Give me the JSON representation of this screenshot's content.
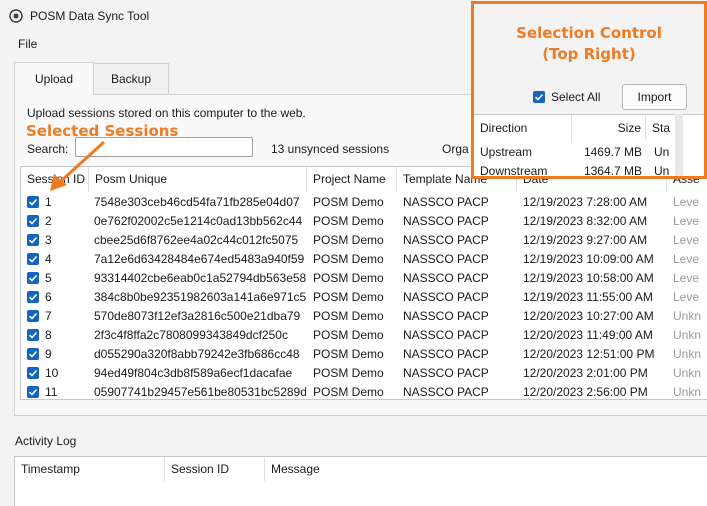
{
  "window": {
    "title": "POSM Data Sync Tool"
  },
  "menu": {
    "file": "File"
  },
  "tabs": [
    {
      "label": "Upload"
    },
    {
      "label": "Backup"
    }
  ],
  "upload": {
    "description": "Upload sessions stored on this computer to the web.",
    "search_label": "Search:",
    "search_value": "",
    "unsynced_count": "13 unsynced sessions",
    "org_label": "Orga"
  },
  "sessions_table": {
    "columns": [
      "Session ID",
      "Posm Unique",
      "Project Name",
      "Template Name",
      "Date",
      "Asse"
    ],
    "rows": [
      {
        "id": "1",
        "posm": "7548e303ceb46cd54fa71fb285e04d07",
        "project": "POSM Demo",
        "template": "NASSCO PACP",
        "date": "12/19/2023 7:28:00 AM",
        "asset": "Leve"
      },
      {
        "id": "2",
        "posm": "0e762f02002c5e1214c0ad13bb562c44",
        "project": "POSM Demo",
        "template": "NASSCO PACP",
        "date": "12/19/2023 8:32:00 AM",
        "asset": "Leve"
      },
      {
        "id": "3",
        "posm": "cbee25d6f8762ee4a02c44c012fc5075",
        "project": "POSM Demo",
        "template": "NASSCO PACP",
        "date": "12/19/2023 9:27:00 AM",
        "asset": "Leve"
      },
      {
        "id": "4",
        "posm": "7a12e6d63428484e674ed5483a940f59",
        "project": "POSM Demo",
        "template": "NASSCO PACP",
        "date": "12/19/2023 10:09:00 AM",
        "asset": "Leve"
      },
      {
        "id": "5",
        "posm": "93314402cbe6eab0c1a52794db563e58",
        "project": "POSM Demo",
        "template": "NASSCO PACP",
        "date": "12/19/2023 10:58:00 AM",
        "asset": "Leve"
      },
      {
        "id": "6",
        "posm": "384c8b0be92351982603a141a6e971c5",
        "project": "POSM Demo",
        "template": "NASSCO PACP",
        "date": "12/19/2023 11:55:00 AM",
        "asset": "Leve"
      },
      {
        "id": "7",
        "posm": "570de8073f12ef3a2816c500e21dba79",
        "project": "POSM Demo",
        "template": "NASSCO PACP",
        "date": "12/20/2023 10:27:00 AM",
        "asset": "Unkn"
      },
      {
        "id": "8",
        "posm": "2f3c4f8ffa2c7808099343849dcf250c",
        "project": "POSM Demo",
        "template": "NASSCO PACP",
        "date": "12/20/2023 11:49:00 AM",
        "asset": "Unkn"
      },
      {
        "id": "9",
        "posm": "d055290a320f8abb79242e3fb686cc48",
        "project": "POSM Demo",
        "template": "NASSCO PACP",
        "date": "12/20/2023 12:51:00 PM",
        "asset": "Unkn"
      },
      {
        "id": "10",
        "posm": "94ed49f804c3db8f589a6ecf1dacafae",
        "project": "POSM Demo",
        "template": "NASSCO PACP",
        "date": "12/20/2023 2:01:00 PM",
        "asset": "Unkn"
      },
      {
        "id": "11",
        "posm": "05907741b29457e561be80531bc5289d",
        "project": "POSM Demo",
        "template": "NASSCO PACP",
        "date": "12/20/2023 2:56:00 PM",
        "asset": "Unkn"
      }
    ]
  },
  "activity_log": {
    "title": "Activity Log",
    "columns": [
      "Timestamp",
      "Session ID",
      "Message"
    ]
  },
  "annotation": {
    "callout_title_line1": "Selection Control",
    "callout_title_line2": "(Top Right)",
    "selected_sessions_label": "Selected Sessions",
    "accent_color": "#ee7a22"
  },
  "selection": {
    "select_all_label": "Select All",
    "import_label": "Import",
    "direction_columns": [
      "Direction",
      "Size",
      "Sta"
    ],
    "direction_rows": [
      {
        "direction": "Upstream",
        "size": "1469.7 MB",
        "status": "Un"
      },
      {
        "direction": "Downstream",
        "size": "1364.7 MB",
        "status": "Un"
      }
    ]
  },
  "colors": {
    "checkbox": "#1565c0",
    "background": "#f3f3f3"
  }
}
